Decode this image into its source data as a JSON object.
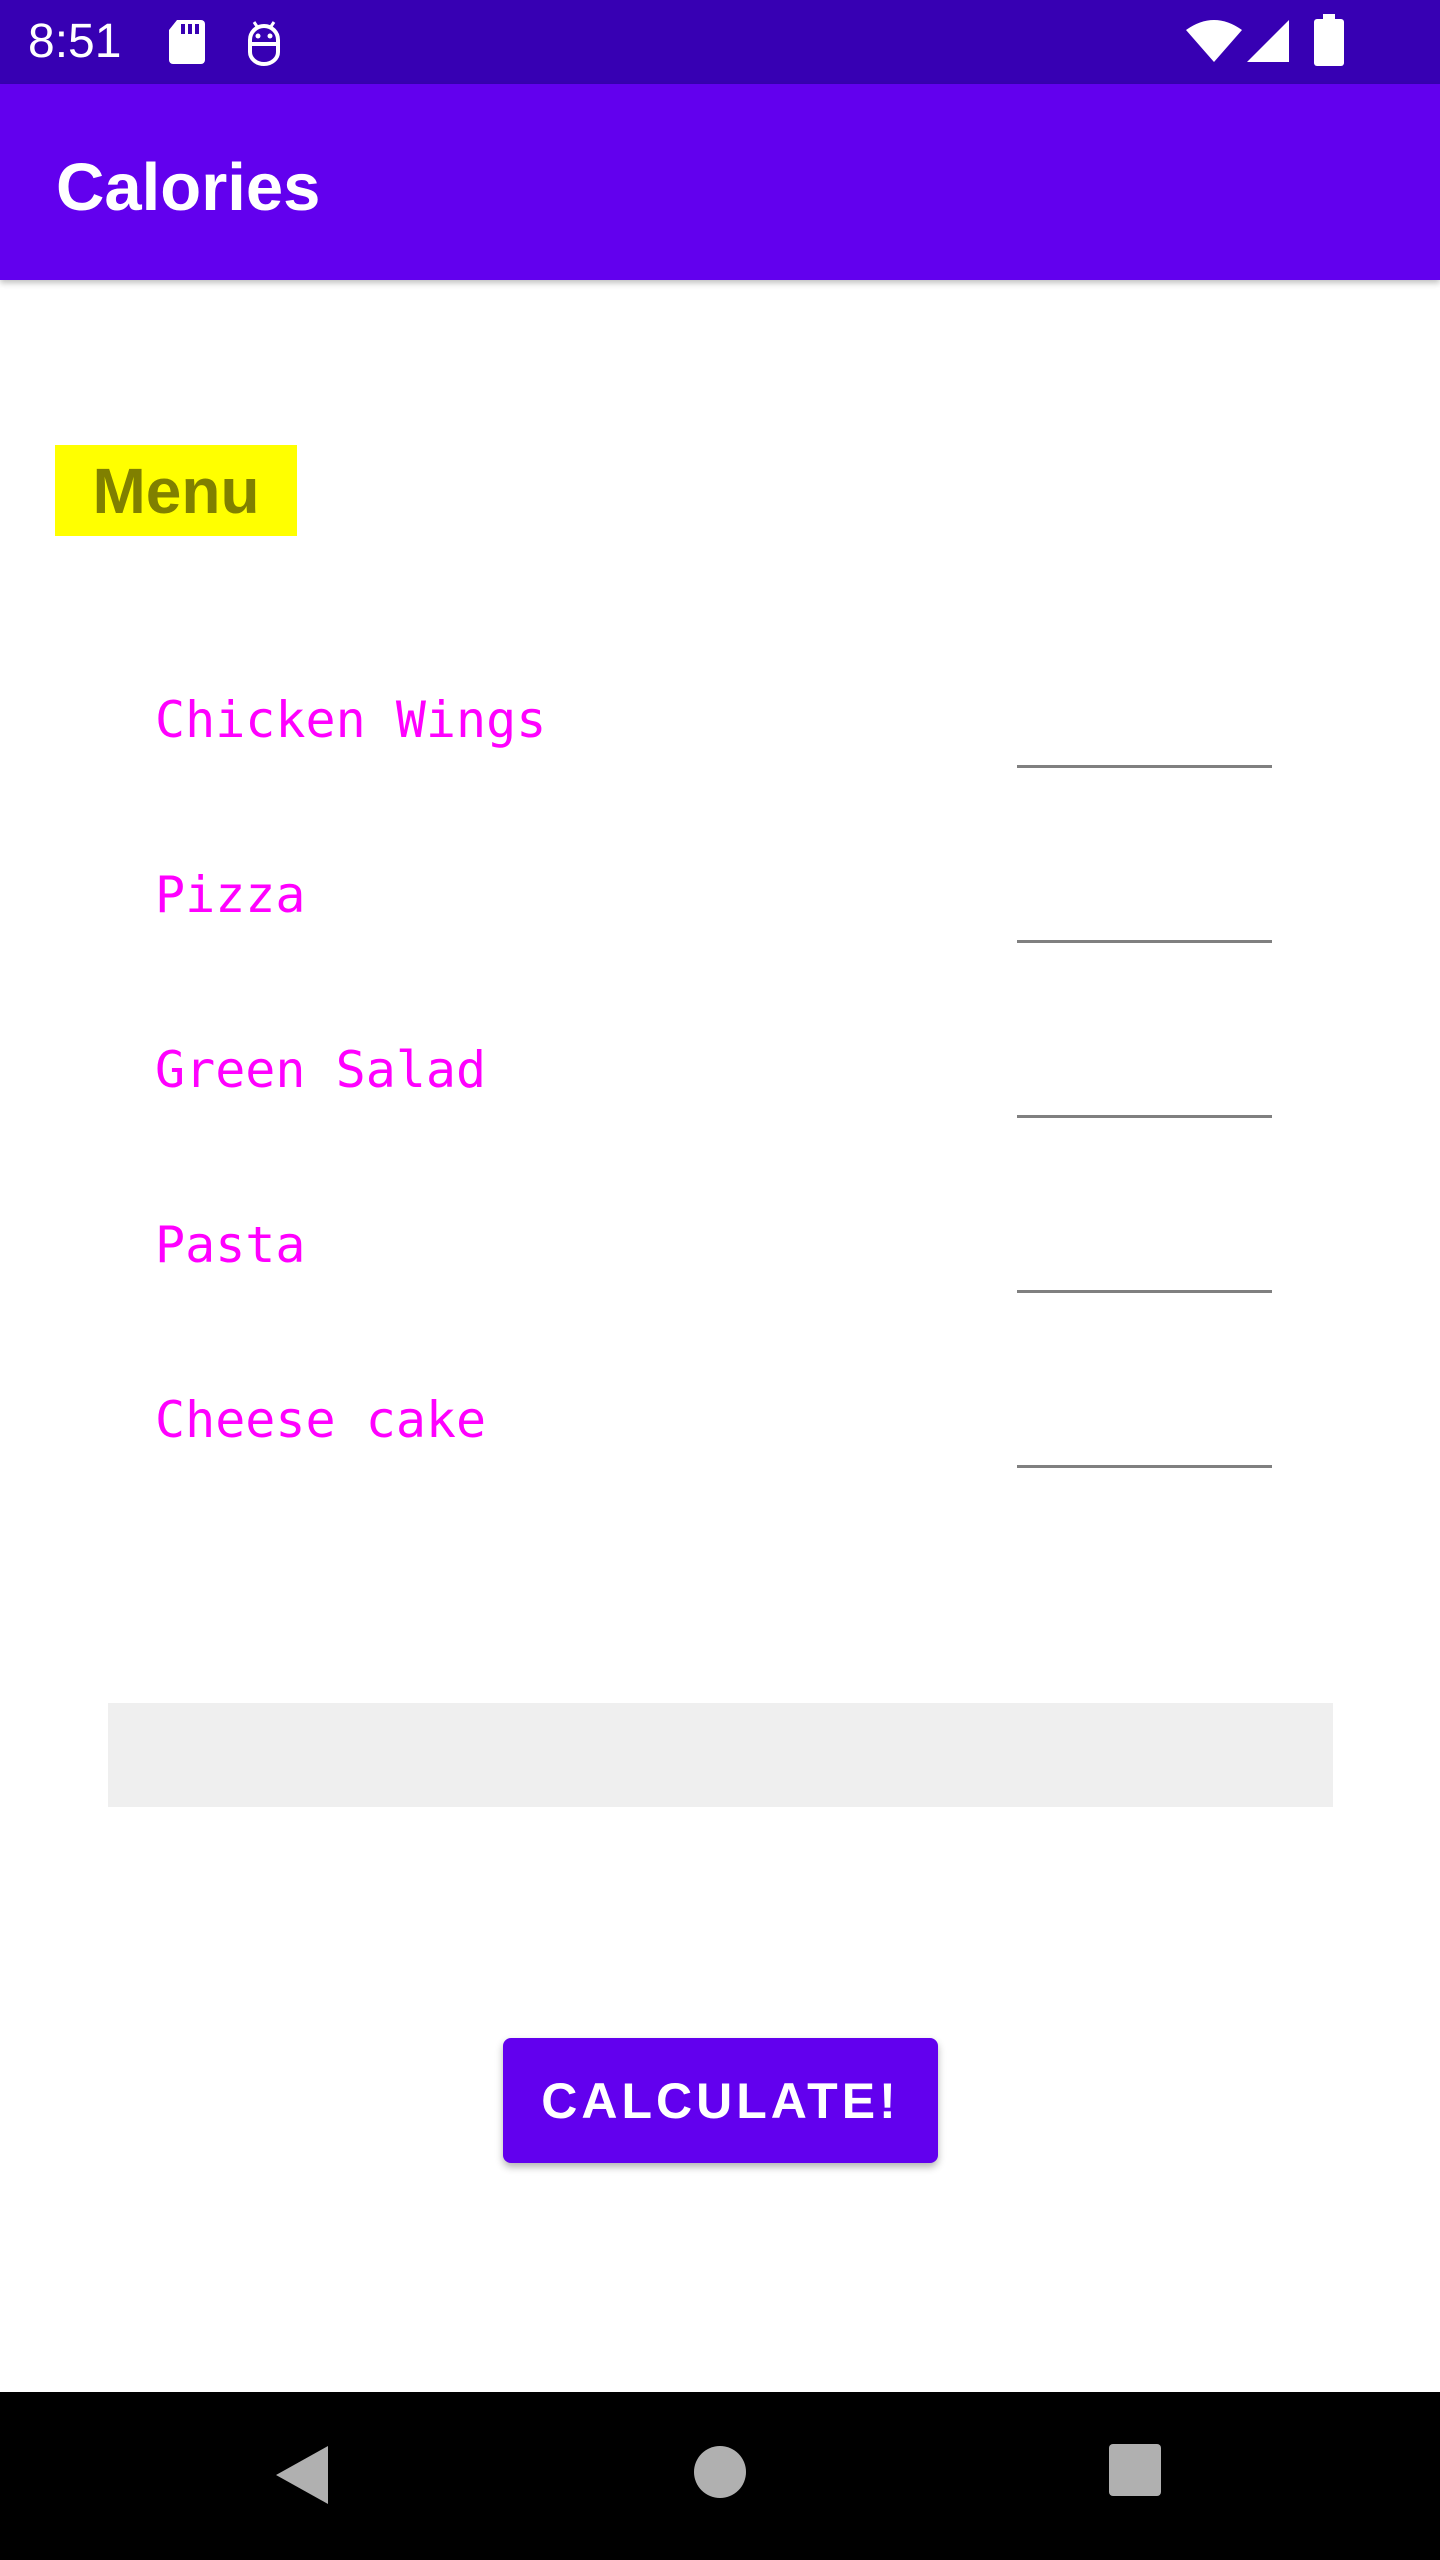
{
  "status_bar": {
    "time": "8:51",
    "icons": [
      "sd-card-icon",
      "android-debug-icon",
      "wifi-icon",
      "cell-signal-icon",
      "battery-icon"
    ]
  },
  "app_bar": {
    "title": "Calories"
  },
  "menu": {
    "heading": "Menu",
    "items": [
      {
        "name": "Chicken Wings",
        "value": ""
      },
      {
        "name": "Pizza",
        "value": ""
      },
      {
        "name": "Green Salad",
        "value": ""
      },
      {
        "name": "Pasta",
        "value": ""
      },
      {
        "name": "Cheese cake",
        "value": ""
      }
    ]
  },
  "result": {
    "text": ""
  },
  "calculate_button": {
    "label": "CALCULATE!"
  },
  "nav_bar": {
    "icons": [
      "back-icon",
      "home-icon",
      "recents-icon"
    ]
  },
  "colors": {
    "status_bar": "#3700b3",
    "app_bar": "#6200ee",
    "menu_highlight": "#ffff00",
    "menu_text": "#808000",
    "food_text": "#ff00ff",
    "button": "#6200ee"
  }
}
